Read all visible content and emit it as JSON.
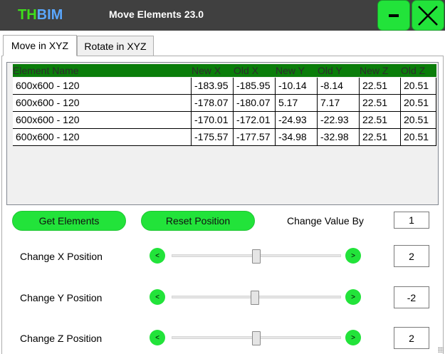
{
  "titlebar": {
    "logo_th": "TH",
    "logo_bim": "BIM",
    "title": "Move Elements 23.0",
    "minimize_label": "–",
    "close_label": "X"
  },
  "tabs": [
    {
      "label": "Move in XYZ",
      "active": true
    },
    {
      "label": "Rotate in XYZ",
      "active": false
    }
  ],
  "table": {
    "headers": [
      "Element Name",
      "New X",
      "Old X",
      "New Y",
      "Old Y",
      "New Z",
      "Old Z"
    ],
    "rows": [
      [
        "600x600 - 120",
        "-183.95",
        "-185.95",
        "-10.14",
        "-8.14",
        "22.51",
        "20.51"
      ],
      [
        "600x600 - 120",
        "-178.07",
        "-180.07",
        "5.17",
        "7.17",
        "22.51",
        "20.51"
      ],
      [
        "600x600 - 120",
        "-170.01",
        "-172.01",
        "-24.93",
        "-22.93",
        "22.51",
        "20.51"
      ],
      [
        "600x600 - 120",
        "-175.57",
        "-177.57",
        "-34.98",
        "-32.98",
        "22.51",
        "20.51"
      ]
    ]
  },
  "actions": {
    "get_elements": "Get Elements",
    "reset_position": "Reset Position",
    "change_value_label": "Change Value By",
    "change_value": "1"
  },
  "sliders": [
    {
      "label": "Change X Position",
      "dec": "<",
      "inc": ">",
      "value": "2",
      "level": 0.5
    },
    {
      "label": "Change Y Position",
      "dec": "<",
      "inc": ">",
      "value": "-2",
      "level": 0.49
    },
    {
      "label": "Change Z Position",
      "dec": "<",
      "inc": ">",
      "value": "2",
      "level": 0.5
    }
  ],
  "colors": {
    "accent_green": "#22e33a",
    "header_green": "#0a7d0a",
    "titlebar": "#404040",
    "logo_th": "#3fe01b",
    "logo_bim": "#5aa7ff"
  }
}
